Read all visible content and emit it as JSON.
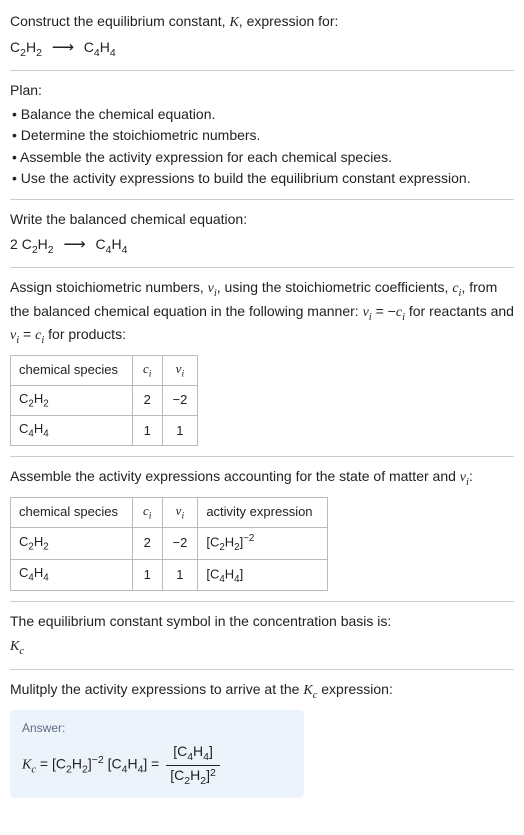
{
  "title_prefix": "Construct the equilibrium constant, ",
  "title_var": "K",
  "title_suffix": ", expression for:",
  "eq_unbalanced_left_coef": "",
  "eq_species_c2h2": "C",
  "eq_species_c2h2_sub1": "2",
  "eq_species_c2h2_h": "H",
  "eq_species_c2h2_sub2": "2",
  "eq_arrow": "⟶",
  "eq_species_c4h4_c": "C",
  "eq_species_c4h4_sub1": "4",
  "eq_species_c4h4_h": "H",
  "eq_species_c4h4_sub2": "4",
  "plan": {
    "heading": "Plan:",
    "items": [
      "Balance the chemical equation.",
      "Determine the stoichiometric numbers.",
      "Assemble the activity expression for each chemical species.",
      "Use the activity expressions to build the equilibrium constant expression."
    ]
  },
  "balanced_heading": "Write the balanced chemical equation:",
  "balanced_coef_left": "2 ",
  "assign_pre": "Assign stoichiometric numbers, ",
  "assign_nu": "ν",
  "assign_sub_i": "i",
  "assign_mid1": ", using the stoichiometric coefficients, ",
  "assign_c": "c",
  "assign_mid2": ", from the balanced chemical equation in the following manner: ",
  "assign_eq1a": "ν",
  "assign_eq1b": " = −",
  "assign_eq1c": "c",
  "assign_mid3": " for reactants and ",
  "assign_eq2a": "ν",
  "assign_eq2b": " = ",
  "assign_eq2c": "c",
  "assign_mid4": " for products:",
  "table1": {
    "h1": "chemical species",
    "h2": "c",
    "h3": "ν",
    "rows": [
      {
        "sp_c": "C",
        "sp_s1": "2",
        "sp_h": "H",
        "sp_s2": "2",
        "c": "2",
        "nu": "−2"
      },
      {
        "sp_c": "C",
        "sp_s1": "4",
        "sp_h": "H",
        "sp_s2": "4",
        "c": "1",
        "nu": "1"
      }
    ]
  },
  "activity_heading_a": "Assemble the activity expressions accounting for the state of matter and ",
  "activity_heading_b": ":",
  "table2": {
    "h1": "chemical species",
    "h2": "c",
    "h3": "ν",
    "h4": "activity expression",
    "rows": [
      {
        "sp_c": "C",
        "sp_s1": "2",
        "sp_h": "H",
        "sp_s2": "2",
        "c": "2",
        "nu": "−2",
        "ae_open": "[",
        "ae_c": "C",
        "ae_s1": "2",
        "ae_h": "H",
        "ae_s2": "2",
        "ae_close": "]",
        "ae_exp": "−2"
      },
      {
        "sp_c": "C",
        "sp_s1": "4",
        "sp_h": "H",
        "sp_s2": "4",
        "c": "1",
        "nu": "1",
        "ae_open": "[",
        "ae_c": "C",
        "ae_s1": "4",
        "ae_h": "H",
        "ae_s2": "4",
        "ae_close": "]",
        "ae_exp": ""
      }
    ]
  },
  "conc_basis_heading": "The equilibrium constant symbol in the concentration basis is:",
  "Kc_sym": "K",
  "Kc_sub": "c",
  "multiply_heading_a": "Mulitply the activity expressions to arrive at the ",
  "multiply_heading_b": " expression:",
  "answer": {
    "label": "Answer:",
    "lhs_K": "K",
    "lhs_sub": "c",
    "equals": " = ",
    "term1_open": "[",
    "term1_c": "C",
    "term1_s1": "2",
    "term1_h": "H",
    "term1_s2": "2",
    "term1_close": "]",
    "term1_exp": "−2",
    "space": " ",
    "term2_open": "[",
    "term2_c": "C",
    "term2_s1": "4",
    "term2_h": "H",
    "term2_s2": "4",
    "term2_close": "]",
    "equals2": " = ",
    "num_open": "[",
    "num_c": "C",
    "num_s1": "4",
    "num_h": "H",
    "num_s2": "4",
    "num_close": "]",
    "den_open": "[",
    "den_c": "C",
    "den_s1": "2",
    "den_h": "H",
    "den_s2": "2",
    "den_close": "]",
    "den_exp": "2"
  },
  "chart_data": {
    "type": "table",
    "stoichiometric_numbers": {
      "columns": [
        "chemical species",
        "c_i",
        "nu_i"
      ],
      "rows": [
        [
          "C2H2",
          2,
          -2
        ],
        [
          "C4H4",
          1,
          1
        ]
      ]
    },
    "activity_expressions": {
      "columns": [
        "chemical species",
        "c_i",
        "nu_i",
        "activity expression"
      ],
      "rows": [
        [
          "C2H2",
          2,
          -2,
          "[C2H2]^-2"
        ],
        [
          "C4H4",
          1,
          1,
          "[C4H4]"
        ]
      ]
    },
    "unbalanced_equation": "C2H2 -> C4H4",
    "balanced_equation": "2 C2H2 -> C4H4",
    "equilibrium_constant": "Kc = [C2H2]^-2 [C4H4] = [C4H4] / [C2H2]^2"
  }
}
